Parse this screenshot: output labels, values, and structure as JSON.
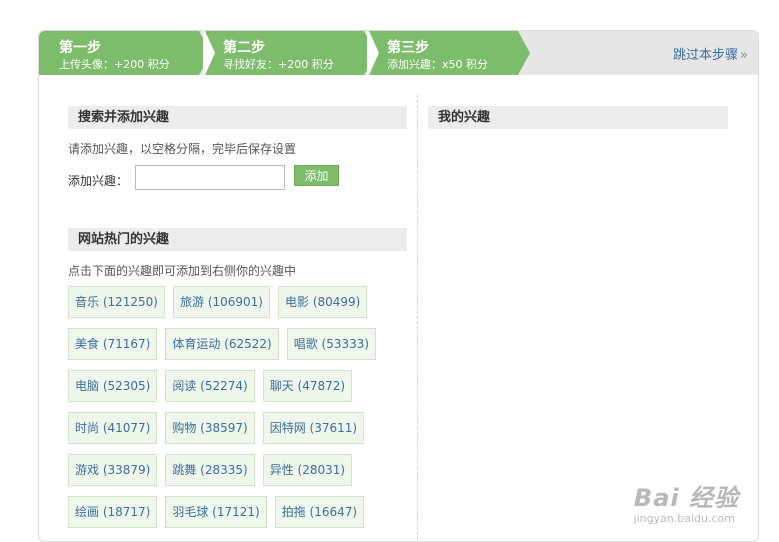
{
  "steps": [
    {
      "title": "第一步",
      "sub": "上传头像：+200 积分"
    },
    {
      "title": "第二步",
      "sub": "寻找好友：+200 积分"
    },
    {
      "title": "第三步",
      "sub": "添加兴趣：x50 积分"
    }
  ],
  "skip_label": "跳过本步骤",
  "skip_icon": "double-chevron-right",
  "search": {
    "heading": "搜索并添加兴趣",
    "hint": "请添加兴趣，以空格分隔，完毕后保存设置",
    "field_label": "添加兴趣：",
    "value": "",
    "button": "添加"
  },
  "my_interests": {
    "heading": "我的兴趣"
  },
  "hot": {
    "heading": "网站热门的兴趣",
    "hint": "点击下面的兴趣即可添加到右侧你的兴趣中",
    "rows": [
      [
        "音乐 (121250)",
        "旅游 (106901)",
        "电影 (80499)"
      ],
      [
        "美食 (71167)",
        "体育运动 (62522)",
        "唱歌 (53333)"
      ],
      [
        "电脑 (52305)",
        "阅读 (52274)",
        "聊天 (47872)"
      ],
      [
        "时尚 (41077)",
        "购物 (38597)",
        "因特网 (37611)"
      ],
      [
        "游戏 (33879)",
        "跳舞 (28335)",
        "异性 (28031)"
      ],
      [
        "绘画 (18717)",
        "羽毛球 (17121)",
        "拍拖 (16647)"
      ]
    ]
  },
  "watermark": {
    "main": "Bai 经验",
    "sub": "jingyan.baidu.com"
  },
  "colors": {
    "accent": "#7cbc6a",
    "link": "#3b6ea5",
    "header_bg": "#ececec"
  }
}
